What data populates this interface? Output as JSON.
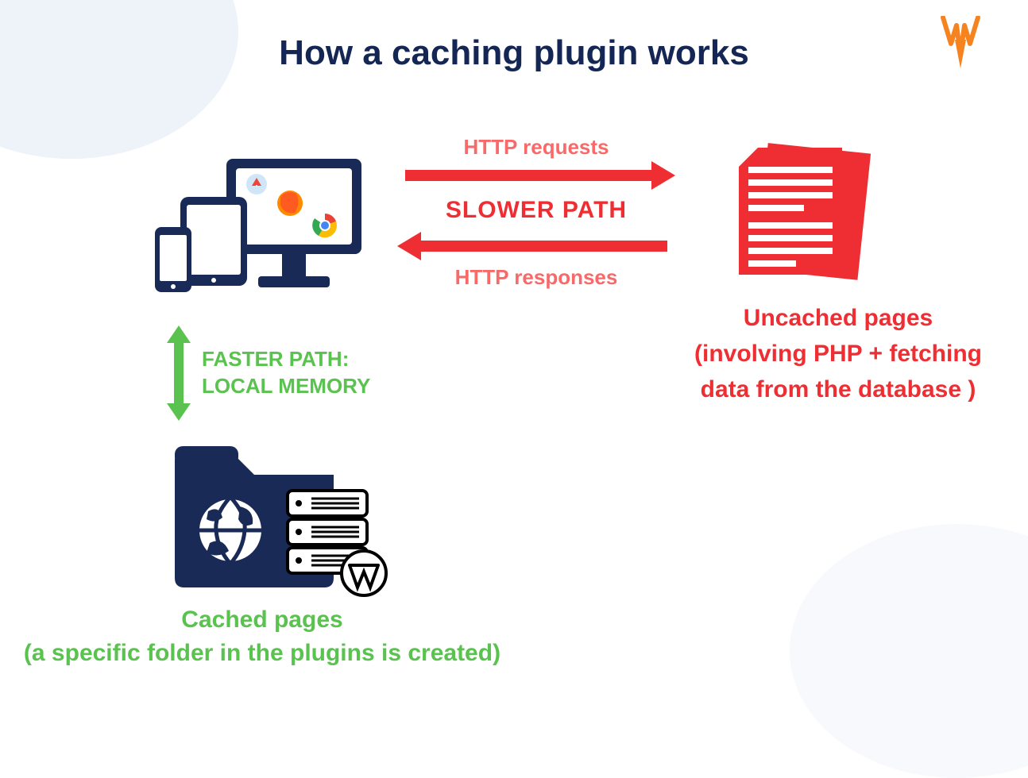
{
  "title": "How a caching plugin works",
  "slower_path": {
    "request_label": "HTTP requests",
    "middle_label": "SLOWER PATH",
    "response_label": "HTTP responses"
  },
  "uncached": {
    "heading": "Uncached pages",
    "sub": "(involving PHP + fetching data from the database )"
  },
  "faster_path": {
    "line1": "FASTER PATH:",
    "line2": "LOCAL MEMORY"
  },
  "cached": {
    "heading": "Cached pages",
    "sub": "(a specific folder in the plugins is created)"
  },
  "colors": {
    "navy": "#142654",
    "red": "#ee2e33",
    "red_light": "#f86a6a",
    "green": "#5ac24e"
  }
}
